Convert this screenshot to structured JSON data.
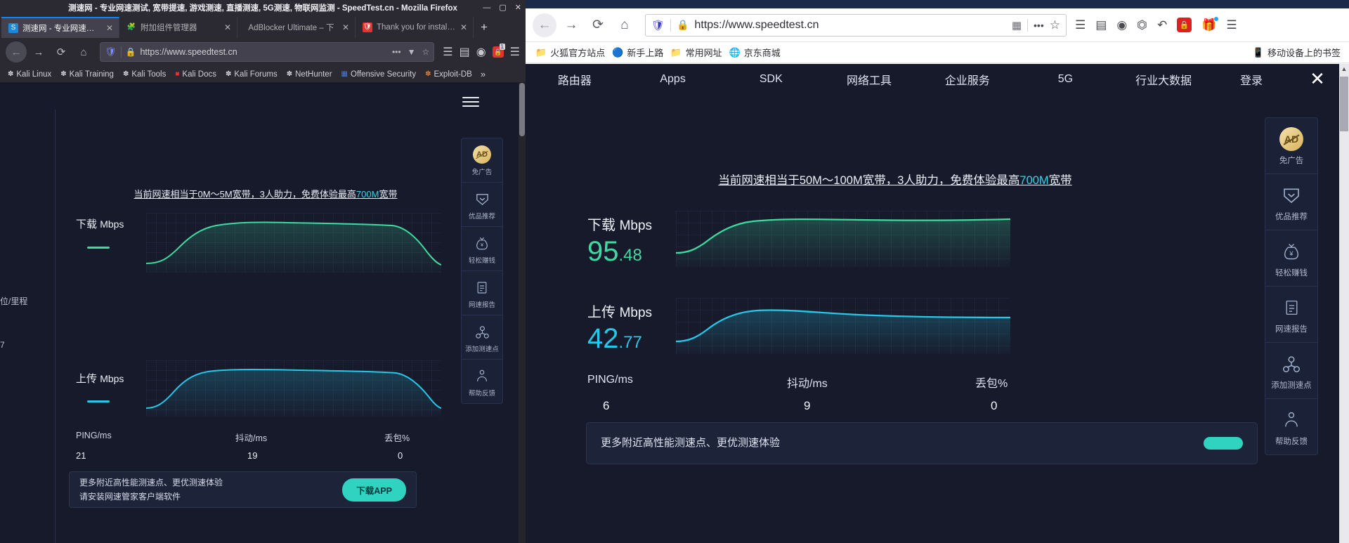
{
  "left_window": {
    "title": "测速网 - 专业网速测试, 宽带提速, 游戏测速, 直播测速, 5G测速, 物联网监测 - SpeedTest.cn - Mozilla Firefox",
    "window_controls": {
      "minimize": "—",
      "maximize": "▢",
      "close": "✕"
    },
    "tabs": [
      {
        "label": "测速网 - 专业网速测试,宽",
        "favicon": "speedtest-favicon",
        "close": "✕",
        "active": true
      },
      {
        "label": "附加组件管理器",
        "favicon": "addons-puzzle-icon",
        "close": "✕",
        "active": false
      },
      {
        "label": "AdBlocker Ultimate – 下",
        "favicon": "none",
        "close": "✕",
        "active": false
      },
      {
        "label": "Thank you for installing",
        "favicon": "shield-red-icon",
        "close": "✕",
        "active": false
      }
    ],
    "new_tab_label": "+",
    "nav": {
      "back": "←",
      "forward": "→",
      "reload": "⟳",
      "home": "⌂"
    },
    "url": "https://www.speedtest.cn",
    "url_icons": {
      "shield": "tracking-shield-icon",
      "lock": "padlock-icon",
      "more": "•••",
      "pocket": "pocket-icon",
      "bookmark": "star-icon"
    },
    "toolbar_icons": {
      "library": "library-icon",
      "sidebar": "sidebar-icon",
      "account": "account-icon",
      "adblock": "adblock-shield-icon",
      "adblock_badge": "1",
      "menu": "hamburger-menu-icon"
    },
    "bookmarks": [
      {
        "label": "Kali Linux",
        "icon": "dragon-icon"
      },
      {
        "label": "Kali Training",
        "icon": "dragon-icon"
      },
      {
        "label": "Kali Tools",
        "icon": "dragon-icon"
      },
      {
        "label": "Kali Docs",
        "icon": "kali-docs-icon"
      },
      {
        "label": "Kali Forums",
        "icon": "dragon-icon"
      },
      {
        "label": "NetHunter",
        "icon": "dragon-icon"
      },
      {
        "label": "Offensive Security",
        "icon": "offsec-icon"
      },
      {
        "label": "Exploit-DB",
        "icon": "exploitdb-icon"
      }
    ],
    "bookmarks_overflow": "»",
    "page": {
      "edge_text_1": "位/里程",
      "edge_text_2": "7",
      "banner_prefix": "当前网速相当于",
      "banner_range": "0M～5M",
      "banner_mid": "宽带，3人助力，免费体验最高",
      "banner_highlight": "700M",
      "banner_suffix": "宽带",
      "download_label": "下载",
      "download_unit": "Mbps",
      "download_value": "",
      "upload_label": "上传",
      "upload_unit": "Mbps",
      "upload_value": "",
      "stats": [
        {
          "header": "PING/ms",
          "value": "21"
        },
        {
          "header": "抖动/ms",
          "value": "19"
        },
        {
          "header": "丢包%",
          "value": "0"
        }
      ],
      "promo_line1": "更多附近高性能测速点、更优测速体验",
      "promo_line2": "请安装网速管家客户端软件",
      "promo_button": "下载APP",
      "rail": [
        {
          "icon": "ad-free-icon",
          "label": "免广告"
        },
        {
          "icon": "recommend-badge-icon",
          "label": "优品推荐"
        },
        {
          "icon": "money-bag-icon",
          "label": "轻松赚钱"
        },
        {
          "icon": "report-doc-icon",
          "label": "网速报告"
        },
        {
          "icon": "add-node-icon",
          "label": "添加测速点"
        },
        {
          "icon": "feedback-icon",
          "label": "帮助反馈"
        }
      ]
    }
  },
  "right_window": {
    "nav": {
      "back": "←",
      "forward": "→",
      "reload": "⟳",
      "home": "⌂"
    },
    "url": "https://www.speedtest.cn",
    "url_icons": {
      "shield": "tracking-shield-icon",
      "lock": "padlock-icon",
      "qr": "qr-code-icon",
      "more": "•••",
      "bookmark": "star-icon"
    },
    "toolbar_icons": {
      "library": "library-icon",
      "sidebar": "sidebar-icon",
      "account": "account-icon",
      "screenshot": "screenshot-crop-icon",
      "undo": "undo-arrow-icon",
      "adblock": "adblock-shield-icon",
      "gift": "gift-icon",
      "menu": "hamburger-menu-icon"
    },
    "bookmarks": [
      {
        "label": "火狐官方站点",
        "icon": "folder-icon"
      },
      {
        "label": "新手上路",
        "icon": "firefox-icon"
      },
      {
        "label": "常用网址",
        "icon": "folder-icon"
      },
      {
        "label": "京东商城",
        "icon": "globe-icon"
      }
    ],
    "mobile_bookmarks": {
      "label": "移动设备上的书签",
      "icon": "mobile-phone-icon"
    },
    "page": {
      "site_nav": [
        "路由器",
        "Apps",
        "SDK",
        "网络工具",
        "企业服务",
        "5G",
        "行业大数据",
        "登录"
      ],
      "close_label": "✕",
      "banner_prefix": "当前网速相当于",
      "banner_range": "50M～100M",
      "banner_mid": "宽带，3人助力，免费体验最高",
      "banner_highlight": "700M",
      "banner_suffix": "宽带",
      "download_label": "下载",
      "download_unit": "Mbps",
      "download_int": "95",
      "download_dec": ".48",
      "upload_label": "上传",
      "upload_unit": "Mbps",
      "upload_int": "42",
      "upload_dec": ".77",
      "stats": [
        {
          "header": "PING/ms",
          "value": "6"
        },
        {
          "header": "抖动/ms",
          "value": "9"
        },
        {
          "header": "丢包%",
          "value": "0"
        }
      ],
      "promo_line1": "更多附近高性能测速点、更优测速体验",
      "promo_button": "",
      "rail": [
        {
          "icon": "ad-free-icon",
          "label": "免广告"
        },
        {
          "icon": "recommend-badge-icon",
          "label": "优品推荐"
        },
        {
          "icon": "money-bag-icon",
          "label": "轻松赚钱"
        },
        {
          "icon": "report-doc-icon",
          "label": "网速报告"
        },
        {
          "icon": "add-node-icon",
          "label": "添加测速点"
        },
        {
          "icon": "feedback-icon",
          "label": "帮助反馈"
        }
      ]
    }
  },
  "colors": {
    "download_line": "#3ddba0",
    "upload_line": "#25c8e8",
    "page_bg": "#171a2b",
    "accent": "#2fd3c0",
    "link_highlight": "#3fd0e8"
  },
  "chart_data": [
    {
      "type": "area",
      "title": "下载 Mbps (left window)",
      "series": [
        {
          "name": "download",
          "values": [
            2,
            2,
            4,
            18,
            52,
            80,
            92,
            95,
            96,
            96,
            96,
            96,
            96,
            96,
            95,
            95,
            95,
            95,
            94,
            94,
            94,
            93,
            90,
            60,
            20,
            4
          ]
        }
      ],
      "color": "#3ddba0",
      "grid": true,
      "ylim": [
        0,
        100
      ],
      "xlabel": "",
      "ylabel": ""
    },
    {
      "type": "area",
      "title": "上传 Mbps (left window)",
      "series": [
        {
          "name": "upload",
          "values": [
            2,
            2,
            6,
            28,
            62,
            82,
            88,
            90,
            90,
            90,
            89,
            89,
            89,
            89,
            88,
            88,
            88,
            88,
            88,
            88,
            87,
            86,
            80,
            48,
            14,
            3
          ]
        }
      ],
      "color": "#25c8e8",
      "grid": true,
      "ylim": [
        0,
        100
      ],
      "xlabel": "",
      "ylabel": ""
    },
    {
      "type": "area",
      "title": "下载 Mbps (right window) = 95.48",
      "series": [
        {
          "name": "download",
          "values": [
            3,
            3,
            5,
            20,
            55,
            82,
            93,
            96,
            96,
            96,
            96,
            96,
            96,
            96,
            95,
            95,
            95,
            95,
            95,
            95,
            95,
            95,
            95,
            95,
            96,
            96
          ]
        }
      ],
      "color": "#3ddba0",
      "grid": true,
      "ylim": [
        0,
        100
      ],
      "xlabel": "",
      "ylabel": ""
    },
    {
      "type": "area",
      "title": "上传 Mbps (right window) = 42.77",
      "series": [
        {
          "name": "upload",
          "values": [
            2,
            2,
            6,
            26,
            58,
            76,
            82,
            84,
            84,
            83,
            83,
            82,
            82,
            82,
            81,
            81,
            81,
            81,
            81,
            81,
            80,
            80,
            80,
            80,
            80,
            80
          ]
        }
      ],
      "color": "#25c8e8",
      "grid": true,
      "ylim": [
        0,
        100
      ],
      "xlabel": "",
      "ylabel": ""
    }
  ]
}
